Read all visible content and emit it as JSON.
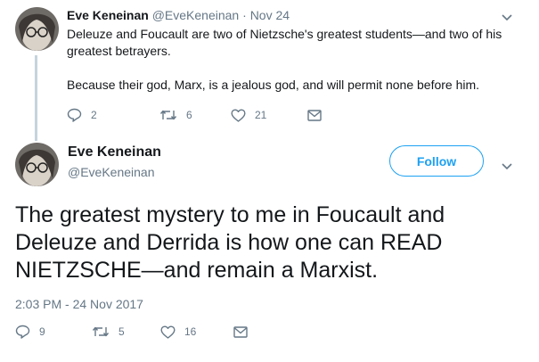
{
  "reply_tweet": {
    "author_name": "Eve Keneinan",
    "author_handle": "@EveKeneinan",
    "separator": "·",
    "date": "Nov 24",
    "text_line1": "Deleuze and Foucault are two of Nietzsche's greatest students—and two of his",
    "text_line2": "greatest betrayers.",
    "text_line3": "Because their god, Marx, is a jealous god, and will permit none before him.",
    "actions": {
      "replies": "2",
      "retweets": "6",
      "likes": "21"
    }
  },
  "main_tweet": {
    "author_name": "Eve Keneinan",
    "author_handle": "@EveKeneinan",
    "follow_label": "Follow",
    "text_line1": "The greatest mystery to me in Foucault and",
    "text_line2": "Deleuze and Derrida is how one can READ",
    "text_line3": "NIETZSCHE—and remain a Marxist.",
    "timestamp": "2:03 PM - 24 Nov 2017",
    "actions": {
      "replies": "9",
      "retweets": "5",
      "likes": "16"
    }
  },
  "colors": {
    "accent": "#1da1f2",
    "secondary_text": "#657786",
    "thread_line": "#c6d3dc"
  },
  "icons": [
    "reply-icon",
    "retweet-icon",
    "like-icon",
    "message-icon",
    "chevron-down-icon"
  ]
}
